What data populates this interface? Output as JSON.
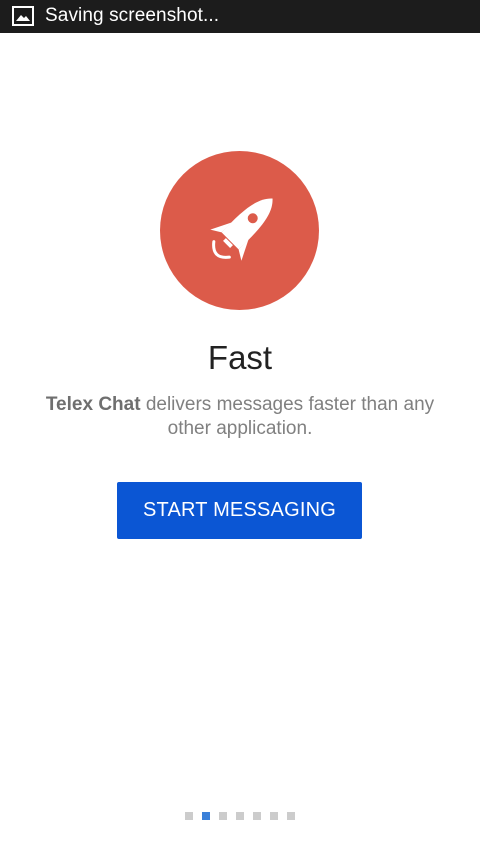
{
  "status_bar": {
    "notification_icon": "image-icon",
    "text": "Saving screenshot..."
  },
  "hero": {
    "icon": "rocket-icon",
    "circle_color": "#dc5b4a"
  },
  "intro": {
    "title": "Fast",
    "app_name": "Telex Chat",
    "description": " delivers messages faster than any other application."
  },
  "button": {
    "label": "START MESSAGING",
    "color": "#0b56d4"
  },
  "pager": {
    "total": 7,
    "active_index": 1,
    "active_color": "#3a80d9",
    "inactive_color": "#cccccc"
  }
}
